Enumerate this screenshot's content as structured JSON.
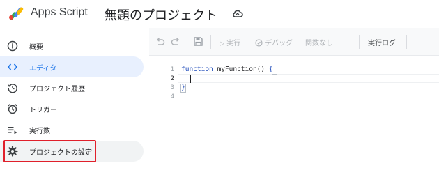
{
  "header": {
    "app_name": "Apps Script",
    "project_title": "無題のプロジェクト",
    "cloud_icon": "cloud-sync-icon"
  },
  "sidebar": {
    "items": [
      {
        "label": "概要",
        "icon": "info-icon"
      },
      {
        "label": "エディタ",
        "icon": "code-icon"
      },
      {
        "label": "プロジェクト履歴",
        "icon": "history-icon"
      },
      {
        "label": "トリガー",
        "icon": "alarm-icon"
      },
      {
        "label": "実行数",
        "icon": "list-play-icon"
      },
      {
        "label": "プロジェクトの設定",
        "icon": "gear-icon"
      }
    ],
    "active_item": "エディタ"
  },
  "toolbar": {
    "undo_icon": "undo-icon",
    "redo_icon": "redo-icon",
    "save_icon": "save-icon",
    "run_label": "実行",
    "debug_label": "デバッグ",
    "function_select": "関数なし",
    "log_label": "実行ログ"
  },
  "editor": {
    "line_numbers": [
      "1",
      "2",
      "3",
      "4"
    ],
    "code": {
      "line1_keyword": "function",
      "line1_name": " myFunction() ",
      "line1_brace": "{",
      "line3_brace": "}"
    }
  },
  "colors": {
    "accent": "#1a73e8",
    "active_bg": "#e8f0fe",
    "highlight_border": "#e0202b"
  }
}
